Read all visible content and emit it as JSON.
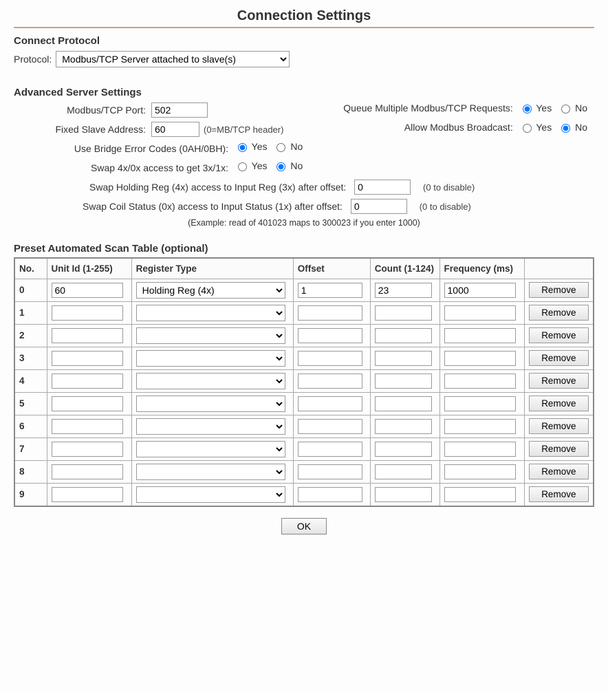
{
  "title": "Connection Settings",
  "connect_protocol": {
    "heading": "Connect Protocol",
    "label": "Protocol:",
    "value": "Modbus/TCP Server attached to slave(s)"
  },
  "advanced": {
    "heading": "Advanced Server Settings",
    "port_label": "Modbus/TCP Port:",
    "port_value": "502",
    "queue_label": "Queue Multiple Modbus/TCP Requests:",
    "fixed_slave_label": "Fixed Slave Address:",
    "fixed_slave_value": "60",
    "fixed_slave_hint": "(0=MB/TCP header)",
    "allow_broadcast_label": "Allow Modbus Broadcast:",
    "bridge_err_label": "Use Bridge Error Codes (0AH/0BH):",
    "swap_access_label": "Swap 4x/0x access to get 3x/1x:",
    "swap_holding_label": "Swap Holding Reg (4x) access to Input Reg (3x) after offset:",
    "swap_holding_value": "0",
    "swap_coil_label": "Swap Coil Status (0x) access to Input Status (1x) after offset:",
    "swap_coil_value": "0",
    "disable_hint": "(0 to disable)",
    "example_text": "(Example: read of 401023 maps to 300023 if you enter 1000)",
    "yes": "Yes",
    "no": "No",
    "queue_yes_checked": true,
    "broadcast_no_checked": true,
    "bridge_yes_checked": true,
    "swap_no_checked": true
  },
  "scan_table": {
    "heading": "Preset Automated Scan Table (optional)",
    "headers": {
      "no": "No.",
      "unit_id": "Unit Id (1-255)",
      "reg_type": "Register Type",
      "offset": "Offset",
      "count": "Count (1-124)",
      "freq": "Frequency (ms)"
    },
    "remove_label": "Remove",
    "rows": [
      {
        "no": "0",
        "unit_id": "60",
        "reg_type": "Holding Reg (4x)",
        "offset": "1",
        "count": "23",
        "freq": "1000"
      },
      {
        "no": "1",
        "unit_id": "",
        "reg_type": "",
        "offset": "",
        "count": "",
        "freq": ""
      },
      {
        "no": "2",
        "unit_id": "",
        "reg_type": "",
        "offset": "",
        "count": "",
        "freq": ""
      },
      {
        "no": "3",
        "unit_id": "",
        "reg_type": "",
        "offset": "",
        "count": "",
        "freq": ""
      },
      {
        "no": "4",
        "unit_id": "",
        "reg_type": "",
        "offset": "",
        "count": "",
        "freq": ""
      },
      {
        "no": "5",
        "unit_id": "",
        "reg_type": "",
        "offset": "",
        "count": "",
        "freq": ""
      },
      {
        "no": "6",
        "unit_id": "",
        "reg_type": "",
        "offset": "",
        "count": "",
        "freq": ""
      },
      {
        "no": "7",
        "unit_id": "",
        "reg_type": "",
        "offset": "",
        "count": "",
        "freq": ""
      },
      {
        "no": "8",
        "unit_id": "",
        "reg_type": "",
        "offset": "",
        "count": "",
        "freq": ""
      },
      {
        "no": "9",
        "unit_id": "",
        "reg_type": "",
        "offset": "",
        "count": "",
        "freq": ""
      }
    ]
  },
  "ok_label": "OK"
}
